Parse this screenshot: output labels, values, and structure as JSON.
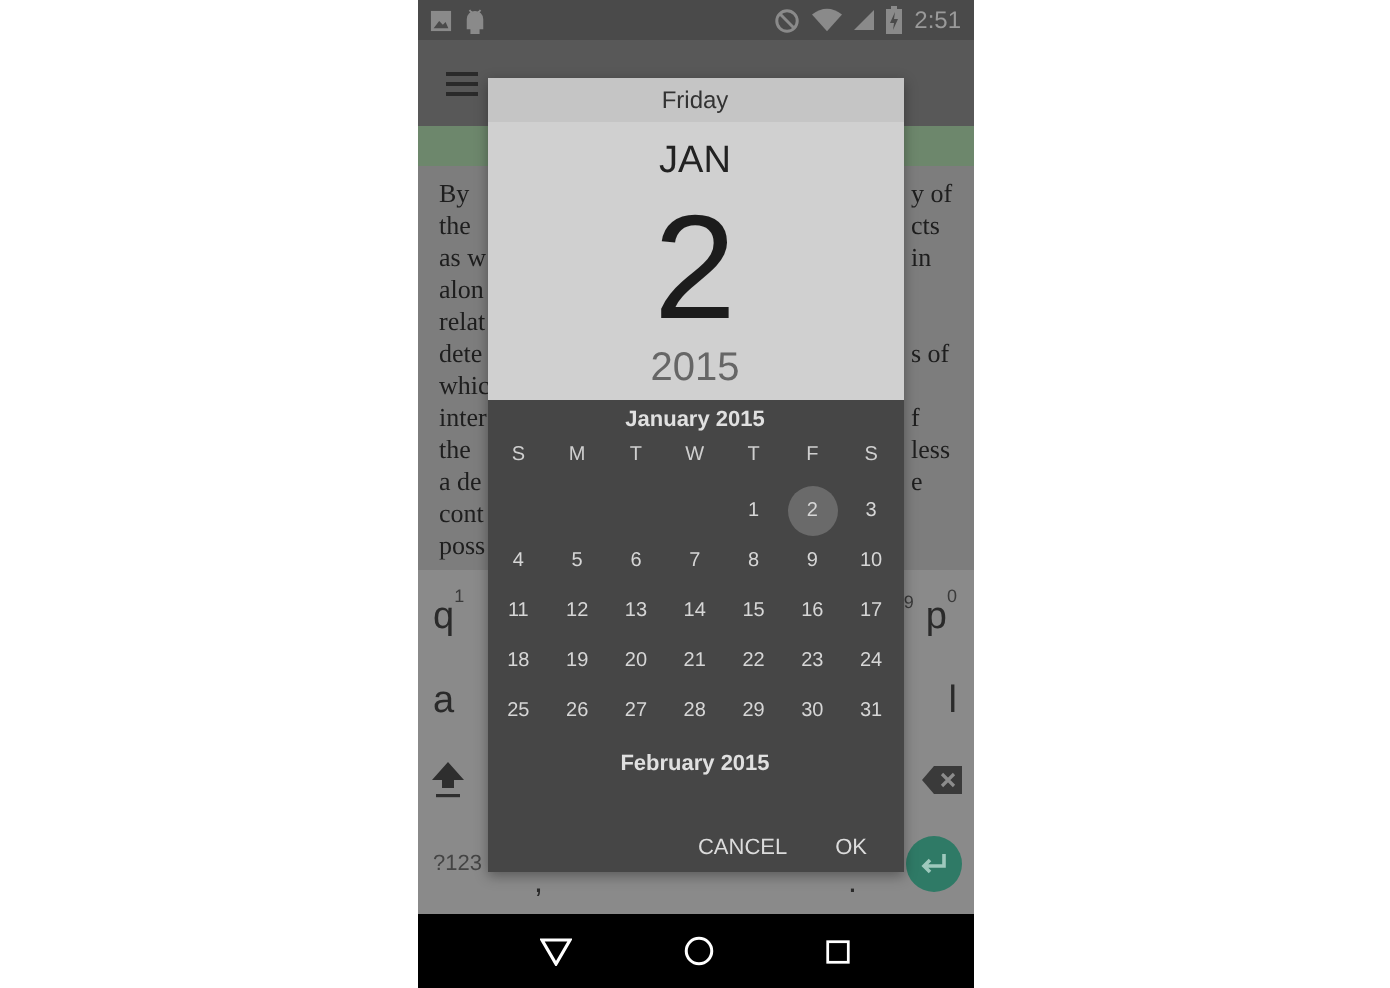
{
  "status_bar": {
    "time": "2:51"
  },
  "body_lines": [
    {
      "left": "By",
      "right": "y of"
    },
    {
      "left": "the",
      "right": "cts"
    },
    {
      "left": "as w",
      "right": "in"
    },
    {
      "left": "alon"
    },
    {
      "left": "relat"
    },
    {
      "left": "dete",
      "right": "s of"
    },
    {
      "left": "whic"
    },
    {
      "left": "inter",
      "right": "f"
    },
    {
      "left": "the",
      "right": "less"
    },
    {
      "left": "a de",
      "right": "e"
    },
    {
      "left": "cont"
    },
    {
      "left": "poss"
    }
  ],
  "keyboard": {
    "rows": [
      {
        "left": [
          {
            "kind": "letter",
            "label": "q",
            "hint": "1"
          }
        ],
        "right": [
          {
            "kind": "hint",
            "hint": "9"
          },
          {
            "kind": "letter",
            "label": "p",
            "hint": "0"
          }
        ]
      },
      {
        "left": [
          {
            "kind": "letter",
            "label": "a"
          }
        ],
        "right": [
          {
            "kind": "letter",
            "label": "l"
          }
        ]
      },
      {
        "left": [
          {
            "kind": "shift"
          }
        ],
        "right": [
          {
            "kind": "backspace"
          }
        ]
      },
      {
        "left": [
          {
            "kind": "symbols",
            "label": "?123"
          },
          {
            "kind": "punct",
            "label": ","
          }
        ],
        "right": [
          {
            "kind": "punct",
            "label": "."
          },
          {
            "kind": "enter"
          }
        ]
      }
    ]
  },
  "dialog": {
    "weekday": "Friday",
    "month": "JAN",
    "day": "2",
    "year": "2015",
    "calendar": {
      "month_title": "January 2015",
      "weekdays": [
        "S",
        "M",
        "T",
        "W",
        "T",
        "F",
        "S"
      ],
      "weeks": [
        [
          {
            "kind": "blank"
          },
          {
            "kind": "blank"
          },
          {
            "kind": "blank"
          },
          {
            "kind": "blank"
          },
          {
            "kind": "day",
            "day": "1",
            "selected": false
          },
          {
            "kind": "day",
            "day": "2",
            "selected": true
          },
          {
            "kind": "day",
            "day": "3",
            "selected": false
          }
        ],
        [
          {
            "kind": "day",
            "day": "4",
            "selected": false
          },
          {
            "kind": "day",
            "day": "5",
            "selected": false
          },
          {
            "kind": "day",
            "day": "6",
            "selected": false
          },
          {
            "kind": "day",
            "day": "7",
            "selected": false
          },
          {
            "kind": "day",
            "day": "8",
            "selected": false
          },
          {
            "kind": "day",
            "day": "9",
            "selected": false
          },
          {
            "kind": "day",
            "day": "10",
            "selected": false
          }
        ],
        [
          {
            "kind": "day",
            "day": "11",
            "selected": false
          },
          {
            "kind": "day",
            "day": "12",
            "selected": false
          },
          {
            "kind": "day",
            "day": "13",
            "selected": false
          },
          {
            "kind": "day",
            "day": "14",
            "selected": false
          },
          {
            "kind": "day",
            "day": "15",
            "selected": false
          },
          {
            "kind": "day",
            "day": "16",
            "selected": false
          },
          {
            "kind": "day",
            "day": "17",
            "selected": false
          }
        ],
        [
          {
            "kind": "day",
            "day": "18",
            "selected": false
          },
          {
            "kind": "day",
            "day": "19",
            "selected": false
          },
          {
            "kind": "day",
            "day": "20",
            "selected": false
          },
          {
            "kind": "day",
            "day": "21",
            "selected": false
          },
          {
            "kind": "day",
            "day": "22",
            "selected": false
          },
          {
            "kind": "day",
            "day": "23",
            "selected": false
          },
          {
            "kind": "day",
            "day": "24",
            "selected": false
          }
        ],
        [
          {
            "kind": "day",
            "day": "25",
            "selected": false
          },
          {
            "kind": "day",
            "day": "26",
            "selected": false
          },
          {
            "kind": "day",
            "day": "27",
            "selected": false
          },
          {
            "kind": "day",
            "day": "28",
            "selected": false
          },
          {
            "kind": "day",
            "day": "29",
            "selected": false
          },
          {
            "kind": "day",
            "day": "30",
            "selected": false
          },
          {
            "kind": "day",
            "day": "31",
            "selected": false
          }
        ]
      ],
      "next_month_title": "February 2015"
    },
    "buttons": [
      "CANCEL",
      "OK"
    ]
  }
}
